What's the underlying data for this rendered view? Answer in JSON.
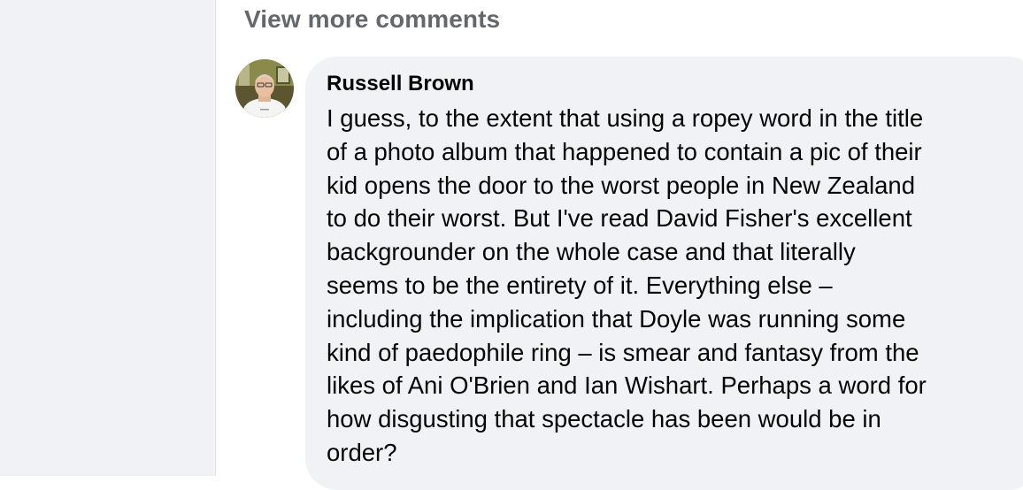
{
  "comments_section": {
    "view_more_label": "View more comments"
  },
  "comment": {
    "author": "Russell Brown",
    "avatar_icon": "user-avatar-photo",
    "text_lines": [
      "I guess, to the extent that using a ropey word in the title",
      "of a photo album that happened to contain a pic of their",
      "kid opens the door to the worst people in New Zealand",
      "to do their worst. But I've read David Fisher's excellent",
      "backgrounder on the whole case and that literally",
      "seems to be the entirety of it. Everything else –",
      "including the implication that Doyle was running some",
      "kind of paedophile ring – is smear and fantasy from the",
      "likes of Ani O'Brien and Ian Wishart. Perhaps a word for",
      "how disgusting that spectacle has been would be in",
      "order?"
    ]
  },
  "colors": {
    "bubble_bg": "#f0f2f5",
    "secondary_text": "#65676b",
    "primary_text": "#050505"
  }
}
